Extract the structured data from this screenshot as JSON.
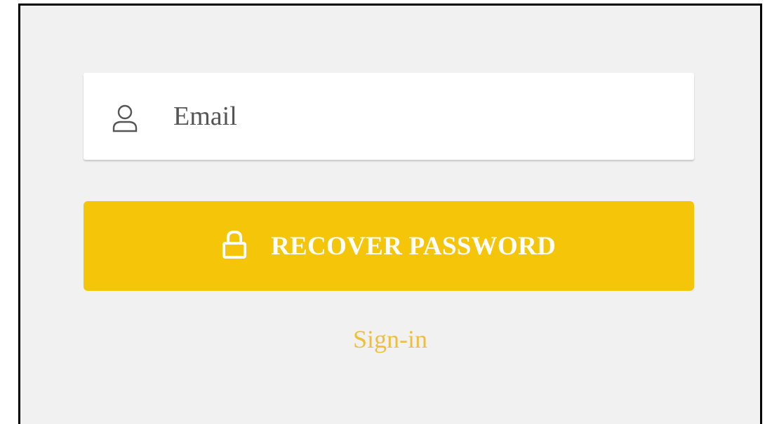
{
  "form": {
    "email": {
      "placeholder": "Email",
      "value": "",
      "icon": "user-icon"
    },
    "recover_button": {
      "label": "RECOVER PASSWORD",
      "icon": "lock-icon"
    },
    "signin_link": {
      "label": "Sign-in"
    }
  },
  "colors": {
    "accent": "#f4c509",
    "link": "#f0bf3a",
    "background": "#f1f1f1",
    "field_background": "#ffffff",
    "placeholder_text": "#555555"
  }
}
